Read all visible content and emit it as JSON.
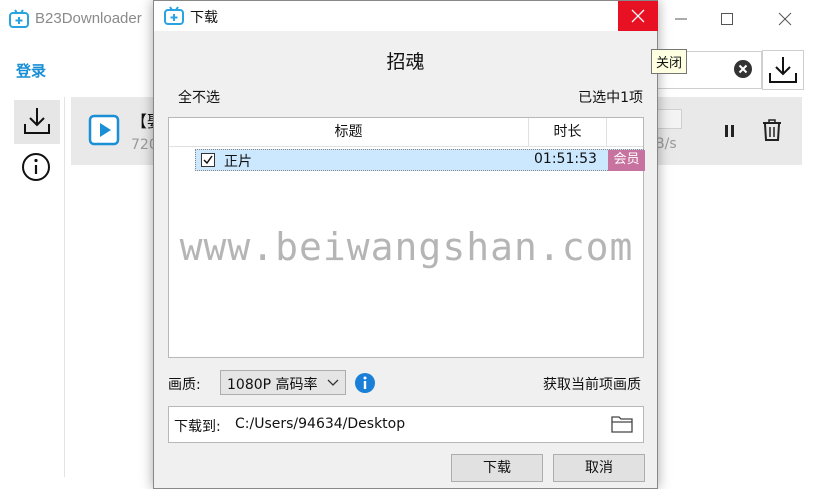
{
  "app": {
    "title": "B23Downloader",
    "login_label": "登录",
    "task": {
      "title": "【娶",
      "subtitle": "720",
      "speed": "B/s"
    }
  },
  "dialog": {
    "window_title": "下载",
    "heading": "招魂",
    "deselect_all": "全不选",
    "selected_count": "已选中1项",
    "columns": {
      "title": "标题",
      "duration": "时长"
    },
    "episodes": [
      {
        "title": "正片",
        "duration": "01:51:53",
        "badge": "会员",
        "checked": true
      }
    ],
    "quality_label": "画质:",
    "quality_value": "1080P 高码率",
    "get_quality_label": "获取当前项画质",
    "path_label": "下载到:",
    "path_value": "C:/Users/94634/Desktop",
    "download_button": "下载",
    "cancel_button": "取消",
    "close_tooltip": "关闭"
  },
  "watermark": "www.beiwangshan.com",
  "colors": {
    "accent_blue": "#1a8fd6",
    "close_red": "#e81123",
    "selection": "#cce8ff",
    "vip_badge": "#c8739f"
  }
}
